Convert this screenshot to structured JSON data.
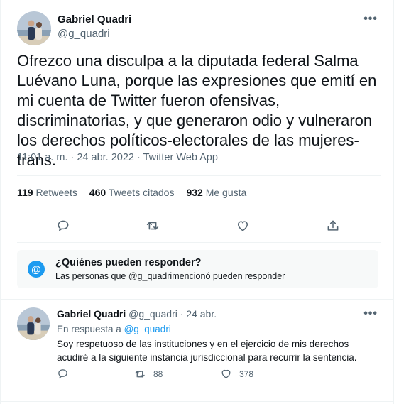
{
  "main_tweet": {
    "author_name": "Gabriel Quadri",
    "author_handle": "@g_quadri",
    "more_label": "•••",
    "text": "Ofrezco una disculpa a la diputada federal Salma Luévano Luna, porque las expresiones que emití en mi cuenta de Twitter fueron ofensivas, discriminatorias, y que generaron odio y vulneraron los derechos políticos-electorales de las mujeres-trans.",
    "time": "11:01 a. m.",
    "separator": " · ",
    "date": "24 abr. 2022",
    "source": "Twitter Web App",
    "stats": {
      "retweets_count": "119",
      "retweets_label": "Retweets",
      "quotes_count": "460",
      "quotes_label": "Tweets citados",
      "likes_count": "932",
      "likes_label": "Me gusta"
    }
  },
  "who_can_reply": {
    "icon_glyph": "@",
    "title": "¿Quiénes pueden responder?",
    "subtitle": "Las personas que @g_quadrimencionó pueden responder"
  },
  "reply_tweet": {
    "author_name": "Gabriel Quadri",
    "author_handle": "@g_quadri",
    "separator": "·",
    "date": "24 abr.",
    "more_label": "•••",
    "in_reply_prefix": "En respuesta a ",
    "in_reply_handle": "@g_quadri",
    "text": "Soy respetuoso de las instituciones y en el ejercicio de mis derechos acudiré a la siguiente instancia jurisdiccional para recurrir la sentencia.",
    "retweets": "88",
    "likes": "378"
  },
  "colors": {
    "accent": "#1d9bf0",
    "text_primary": "#0f1419",
    "text_secondary": "#536471",
    "divider": "#eff3f4"
  },
  "icons": [
    "reply-icon",
    "retweet-icon",
    "like-icon",
    "share-icon",
    "at-icon",
    "more-icon"
  ]
}
